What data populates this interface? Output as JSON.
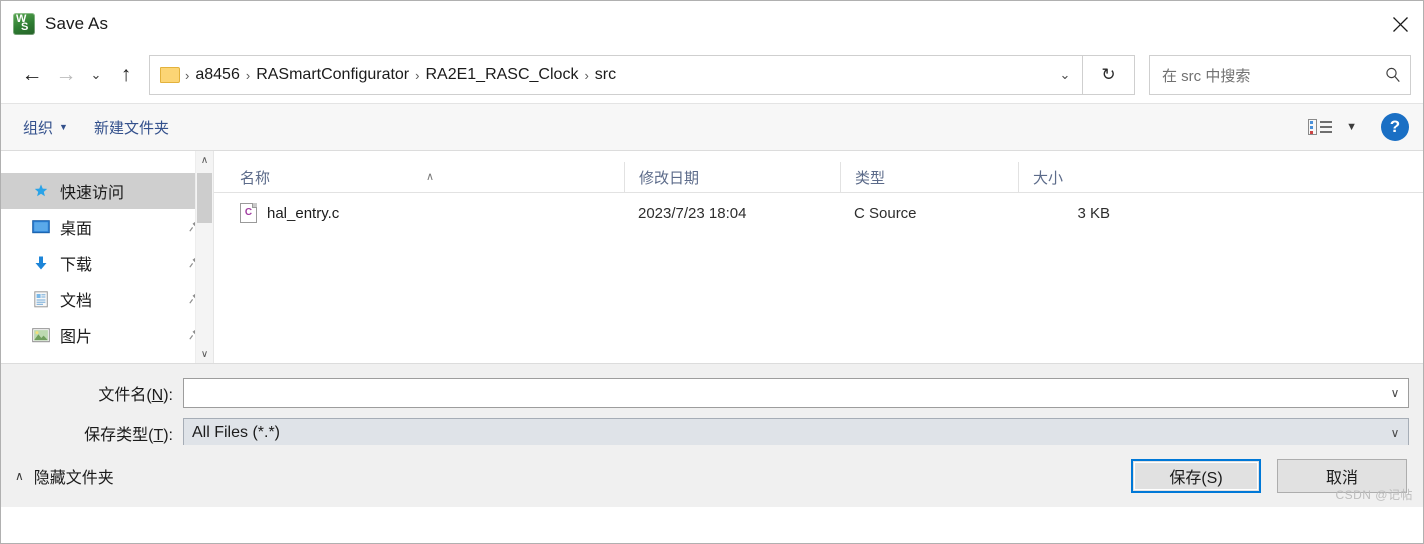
{
  "window": {
    "title": "Save As",
    "app_icon": "wps-app-icon",
    "close_label": "✕"
  },
  "nav": {
    "back_icon": "back-arrow-icon",
    "forward_icon": "forward-arrow-icon",
    "recent_icon": "chevron-down-icon",
    "up_icon": "up-arrow-icon",
    "refresh_icon": "refresh-icon",
    "breadcrumbs": [
      {
        "label": "a8456"
      },
      {
        "label": "RASmartConfigurator"
      },
      {
        "label": "RA2E1_RASC_Clock"
      },
      {
        "label": "src"
      }
    ],
    "separator": "›"
  },
  "search": {
    "placeholder": "在 src 中搜索",
    "icon": "search-icon"
  },
  "toolbar": {
    "organize_label": "组织",
    "organize_caret": "▼",
    "new_folder_label": "新建文件夹",
    "view_icon": "view-options-icon",
    "view_caret": "▼",
    "help_label": "?",
    "text_color": "#33508c"
  },
  "sidebar": {
    "items": [
      {
        "label": "快速访问",
        "icon": "star-icon",
        "selected": true,
        "pinned": false
      },
      {
        "label": "桌面",
        "icon": "desktop-icon",
        "selected": false,
        "pinned": true
      },
      {
        "label": "下载",
        "icon": "download-icon",
        "selected": false,
        "pinned": true
      },
      {
        "label": "文档",
        "icon": "document-icon",
        "selected": false,
        "pinned": true
      },
      {
        "label": "图片",
        "icon": "pictures-icon",
        "selected": false,
        "pinned": true
      }
    ],
    "pin_glyph": "📌",
    "scroll_up": "∧",
    "scroll_down": "∨",
    "selection_color": "#cfcfcf"
  },
  "filelist": {
    "columns": [
      {
        "label": "名称",
        "key": "name"
      },
      {
        "label": "修改日期",
        "key": "date"
      },
      {
        "label": "类型",
        "key": "type"
      },
      {
        "label": "大小",
        "key": "size"
      }
    ],
    "sort_caret": "∧",
    "rows": [
      {
        "name": "hal_entry.c",
        "date": "2023/7/23 18:04",
        "type": "C Source",
        "size": "3 KB",
        "icon": "c-source-file-icon",
        "icon_letter": "C"
      }
    ]
  },
  "form": {
    "filename_label_pre": "文件名(",
    "filename_label_key": "N",
    "filename_label_post": "):",
    "filename_value": "",
    "filename_placeholder": "",
    "savetype_label_pre": "保存类型(",
    "savetype_label_key": "T",
    "savetype_label_post": "):",
    "savetype_value": "All Files (*.*)",
    "chevron": "∨"
  },
  "footer": {
    "hide_folders_caret": "∧",
    "hide_folders_label": "隐藏文件夹",
    "save_label": "保存(S)",
    "cancel_label": "取消",
    "watermark": "CSDN @记帖",
    "focus_color": "#0078d7"
  }
}
